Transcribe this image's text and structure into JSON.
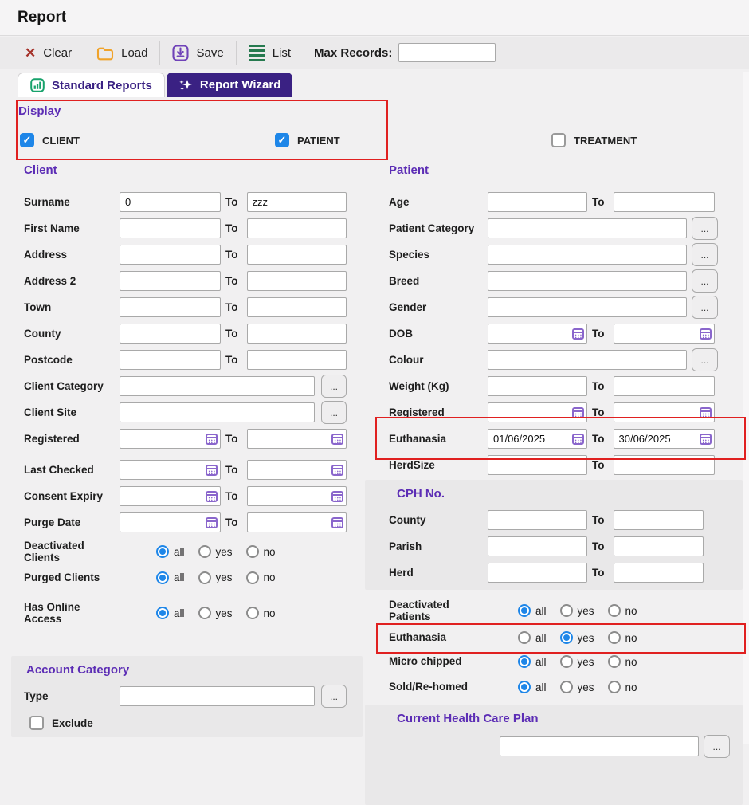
{
  "window": {
    "title": "Report"
  },
  "toolbar": {
    "clear": "Clear",
    "load": "Load",
    "save": "Save",
    "list": "List",
    "max_records_label": "Max Records:",
    "max_records_value": ""
  },
  "tabs": {
    "standard_reports": "Standard Reports",
    "report_wizard": "Report Wizard",
    "active_tab": "Report Wizard"
  },
  "common": {
    "to": "To",
    "ellipsis": "...",
    "options": {
      "all": "all",
      "yes": "yes",
      "no": "no"
    }
  },
  "display": {
    "heading": "Display",
    "client": {
      "label": "CLIENT",
      "checked": true
    },
    "patient": {
      "label": "PATIENT",
      "checked": true
    },
    "treatment": {
      "label": "TREATMENT",
      "checked": false
    }
  },
  "client": {
    "heading": "Client",
    "surname": {
      "label": "Surname",
      "from": "0",
      "to": "zzz"
    },
    "first_name": {
      "label": "First Name",
      "from": "",
      "to": ""
    },
    "address": {
      "label": "Address",
      "from": "",
      "to": ""
    },
    "address2": {
      "label": "Address 2",
      "from": "",
      "to": ""
    },
    "town": {
      "label": "Town",
      "from": "",
      "to": ""
    },
    "county": {
      "label": "County",
      "from": "",
      "to": ""
    },
    "postcode": {
      "label": "Postcode",
      "from": "",
      "to": ""
    },
    "client_category": {
      "label": "Client Category",
      "value": ""
    },
    "client_site": {
      "label": "Client Site",
      "value": ""
    },
    "registered": {
      "label": "Registered",
      "from": "",
      "to": ""
    },
    "last_checked": {
      "label": "Last Checked",
      "from": "",
      "to": ""
    },
    "consent_expiry": {
      "label": "Consent Expiry",
      "from": "",
      "to": ""
    },
    "purge_date": {
      "label": "Purge Date",
      "from": "",
      "to": ""
    },
    "deactivated_clients": {
      "label": "Deactivated Clients",
      "selected": "all"
    },
    "purged_clients": {
      "label": "Purged Clients",
      "selected": "all"
    },
    "has_online_access": {
      "label": "Has Online Access",
      "selected": "all"
    }
  },
  "account_category": {
    "heading": "Account Category",
    "type_label": "Type",
    "type_value": "",
    "exclude_label": "Exclude",
    "exclude_checked": false
  },
  "patient": {
    "heading": "Patient",
    "age": {
      "label": "Age",
      "from": "",
      "to": ""
    },
    "patient_category": {
      "label": "Patient Category",
      "value": ""
    },
    "species": {
      "label": "Species",
      "value": ""
    },
    "breed": {
      "label": "Breed",
      "value": ""
    },
    "gender": {
      "label": "Gender",
      "value": ""
    },
    "dob": {
      "label": "DOB",
      "from": "",
      "to": ""
    },
    "colour": {
      "label": "Colour",
      "value": ""
    },
    "weight": {
      "label": "Weight (Kg)",
      "from": "",
      "to": ""
    },
    "registered": {
      "label": "Registered",
      "from": "",
      "to": ""
    },
    "euthanasia_date": {
      "label": "Euthanasia",
      "from": "01/06/2025",
      "to": "30/06/2025"
    },
    "herdsize": {
      "label": "HerdSize",
      "from": "",
      "to": ""
    },
    "deactivated_patients": {
      "label": "Deactivated Patients",
      "selected": "all"
    },
    "euthanasia": {
      "label": "Euthanasia",
      "selected": "yes"
    },
    "micro_chipped": {
      "label": "Micro chipped",
      "selected": "all"
    },
    "sold_rehomed": {
      "label": "Sold/Re-homed",
      "selected": "all"
    }
  },
  "cph": {
    "heading": "CPH No.",
    "county": {
      "label": "County",
      "from": "",
      "to": ""
    },
    "parish": {
      "label": "Parish",
      "from": "",
      "to": ""
    },
    "herd": {
      "label": "Herd",
      "from": "",
      "to": ""
    }
  },
  "health_plan": {
    "heading": "Current Health Care Plan",
    "value": ""
  },
  "colors": {
    "accent_purple": "#5c2db5",
    "tab_purple": "#3a2183",
    "selection_blue": "#1e86e8",
    "highlight_red": "#e02020"
  }
}
